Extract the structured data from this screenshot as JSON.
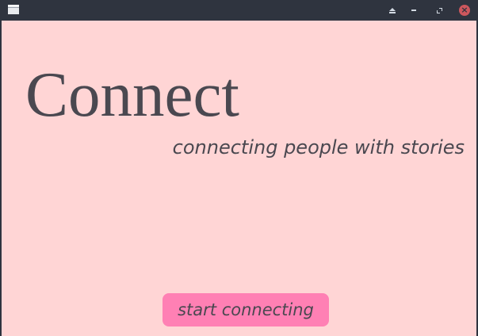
{
  "window": {
    "controls": {
      "shade_icon": "eject-icon",
      "minimize_icon": "minimize-icon",
      "maximize_icon": "maximize-icon",
      "close_icon": "close-icon",
      "close_glyph": "×"
    }
  },
  "main": {
    "title": "Connect",
    "tagline": "connecting people with stories",
    "start_button_label": "start connecting"
  },
  "colors": {
    "titlebar": "#2f343f",
    "background": "#ffd5d5",
    "button": "#ff80b4",
    "text": "#4a4850",
    "close": "#cc575d"
  }
}
